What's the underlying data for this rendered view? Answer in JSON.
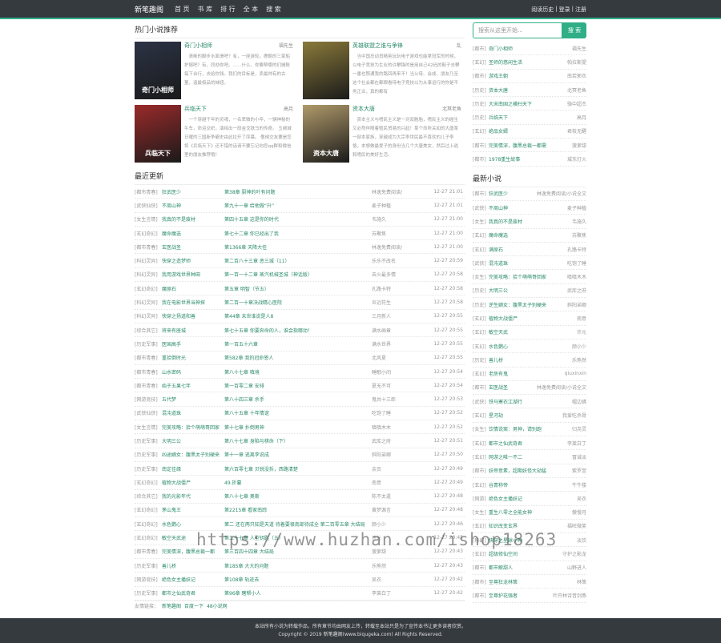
{
  "header": {
    "logo": "新笔趣阁",
    "nav": [
      "首 页",
      "书 库",
      "排 行",
      "全 本",
      "搜 索"
    ],
    "user_links": [
      "阅读历史",
      "|",
      "登录",
      "|",
      "注册"
    ]
  },
  "hot": {
    "title": "热门小说推荐",
    "books": [
      {
        "name": "奇门小相师",
        "author": "福先生",
        "cover_text": "奇门小相师",
        "cover_color": "#2c3346",
        "desc": "清晰的脚步水面滑吧？有，一座游轮。鹿鲍的三家船护撼吧？有，同劫你吧。……什么，你要帮哪的们摊账每下台行，去给你钱。我们的目标是，卖最帅有的古董，追最极品的妹妞。"
      },
      {
        "name": "英雄联盟之谁与争锋",
        "author": "乱",
        "cover_text": "",
        "cover_color": "#8a7a3a",
        "desc": "当中国总动员精英玩玩电子游戏也能拿冠军的时候，以电子竞技为生业的许攀锋的是用自己42码的鞋子去攀一番也照通我的路回再来不！当公母、会成、朋友乃至这个社会都在都眼看待电子竞技以为从事运行的你是不务正业，真的都有"
      },
      {
        "name": "兵临天下",
        "author": "高月",
        "cover_text": "兵临天下",
        "cover_color": "#9b2a2a",
        "desc": "一个穿越千年的灵魂，一名卑微的小卒，一辆神秘的牛车，命运交织，演绎出一段金戈铁马的传奇。 玉阙城日曜的三国新争霸史由此拉开了序幕。 敬候交友要是您将《兵临天下》还不错的话请不要忘记向您qq群和微信里的朋友推荐哦！"
      },
      {
        "name": "资本大唐",
        "author": "北冥老鱼",
        "cover_text": "资本大唐",
        "cover_color": "#b09a6a",
        "desc": "资本主义与嗜民主义是一对双胞胎，嗜民主义的碰生又必然伴随着殖民贸易的兴起！某个命所关如的大唐某一部本家族，穿越成为大宗李世民最不喜欢的儿子李恪，本想做最爱子的身份当几个大唐美女，然后过上逍和嗜民的美好生活。"
      }
    ]
  },
  "search": {
    "placeholder": "搜索从这里开始...",
    "button": "搜 索"
  },
  "side_top": [
    {
      "cat": "[都市]",
      "title": "奇门小相师",
      "author": "福先生"
    },
    {
      "cat": "[玄幻]",
      "title": "圣师的悠闲生活",
      "author": "帕拉斯提"
    },
    {
      "cat": "[都市]",
      "title": "游戏王朝",
      "author": "南若郭衣"
    },
    {
      "cat": "[历史]",
      "title": "资本大唐",
      "author": "北冥老鱼"
    },
    {
      "cat": "[历史]",
      "title": "大宋南国之横扫天下",
      "author": "骆中超杰"
    },
    {
      "cat": "[历史]",
      "title": "兵临天下",
      "author": "高月"
    },
    {
      "cat": "[玄幻]",
      "title": "绝品女婿",
      "author": "君枝无醒"
    },
    {
      "cat": "[都市]",
      "title": "完美情深，腹黑总裁一都需",
      "author": "菠萝甜"
    },
    {
      "cat": "[都市]",
      "title": "1978重生故事",
      "author": "城东灯火"
    }
  ],
  "latest": {
    "title": "最近更新",
    "rows": [
      {
        "cat": "[都市青春]",
        "title": "狂武医少",
        "chapter": "第38章 厨神的叶有问题",
        "author": "林逸免费阅读/",
        "time": "12-27 21:01"
      },
      {
        "cat": "[武侠仙侠]",
        "title": "不周山神",
        "chapter": "第九十一章 给他做“升”",
        "author": "麦子种植",
        "time": "12-27 21:01"
      },
      {
        "cat": "[女生言情]",
        "title": "我真的不是废材",
        "chapter": "第四十五章 这是你的时代",
        "author": "韦施久",
        "time": "12-27 21:00"
      },
      {
        "cat": "[玄幻奇幻]",
        "title": "魔命魔选",
        "chapter": "第七十二章 你已经出了我",
        "author": "苏聚焦",
        "time": "12-27 21:00"
      },
      {
        "cat": "[都市青春]",
        "title": "玄医战圣",
        "chapter": "第1366章 天降大任",
        "author": "林逸免费阅读/",
        "time": "12-27 21:00"
      },
      {
        "cat": "[科幻灵异]",
        "title": "快穿之造梦师",
        "chapter": "第二百八十三章 恶三城（11）",
        "author": "乐乐不改名",
        "time": "12-27 20:59"
      },
      {
        "cat": "[科幻灵异]",
        "title": "我用游戏世界种田",
        "chapter": "第一百一十二章 蒸汽机械圣城（神话版）",
        "author": "去火最多情",
        "time": "12-27 20:58"
      },
      {
        "cat": "[玄幻奇幻]",
        "title": "魔原石",
        "chapter": "第五章 明智（节五）",
        "author": "孔路卡特",
        "time": "12-27 20:58"
      },
      {
        "cat": "[科幻灵异]",
        "title": "我在电影世界当神探",
        "chapter": "第二百一十章决战精心医院",
        "author": "炎远符生",
        "time": "12-27 20:58"
      },
      {
        "cat": "[科幻灵异]",
        "title": "快穿之扬道和善",
        "chapter": "第44章 末世谁说是人8",
        "author": "三月新人",
        "time": "12-27 20:55"
      },
      {
        "cat": "[综合其它]",
        "title": "将来有座城",
        "chapter": "第七十五章 你要奔命的人，谁会指哪动！",
        "author": "满水画章",
        "time": "12-27 20:55"
      },
      {
        "cat": "[历史军事]",
        "title": "医国高手",
        "chapter": "第一百五十六章",
        "author": "满水世界",
        "time": "12-27 20:55"
      },
      {
        "cat": "[都市青春]",
        "title": "重拾倒时光",
        "chapter": "第582章 我的冠命恩人",
        "author": "北风夏",
        "time": "12-27 20:55"
      },
      {
        "cat": "[都市青春]",
        "title": "山水密码",
        "chapter": "第八十七章 嗔境",
        "author": "睡眠小间",
        "time": "12-27 20:54"
      },
      {
        "cat": "[都市青春]",
        "title": "始于五果七年",
        "chapter": "第一百零二章 安排",
        "author": "夏无不可",
        "time": "12-27 20:54"
      },
      {
        "cat": "[网游竞技]",
        "title": "五代梦",
        "chapter": "第八十四三章 杀手",
        "author": "鬼共十三郎",
        "time": "12-27 20:53"
      },
      {
        "cat": "[武侠仙侠]",
        "title": "混沌道珠",
        "chapter": "第八十五章 十年情谊",
        "author": "吃饱了睡",
        "time": "12-27 20:52"
      },
      {
        "cat": "[女生言情]",
        "title": "完美攻略：拾个萌萌哥回家",
        "chapter": "第十七章 扑倒男神",
        "author": "嗔嗔木木",
        "time": "12-27 20:52"
      },
      {
        "cat": "[历史军事]",
        "title": "大明三公",
        "chapter": "第八十七章 身陷与棋命（下）",
        "author": "武库之府",
        "time": "12-27 20:51"
      },
      {
        "cat": "[历史军事]",
        "title": "凶途嫡女：腹黑太子别硬来",
        "chapter": "第十一章 逃离李说成",
        "author": "斜阳弟卿",
        "time": "12-27 20:50"
      },
      {
        "cat": "[历史军事]",
        "title": "南定佳缘",
        "chapter": "第六百零七章 贝锐没拆，西路清楚",
        "author": "余页",
        "time": "12-27 20:49"
      },
      {
        "cat": "[玄幻奇幻]",
        "title": "植物大战僵尸",
        "chapter": "49.折蔓",
        "author": "南意",
        "time": "12-27 20:49"
      },
      {
        "cat": "[综合其它]",
        "title": "我的光影年代",
        "chapter": "第八十七章 奥斯",
        "author": "陈不太遣",
        "time": "12-27 20:48"
      },
      {
        "cat": "[玄幻奇幻]",
        "title": "茅山鬼王",
        "chapter": "第2215章 看家南踪",
        "author": "黄梦源言",
        "time": "12-27 20:48"
      },
      {
        "cat": "[玄幻奇幻]",
        "title": "水色鹦心",
        "chapter": "第二 还在两只知是天道 待着要很南部待成全 第二百零五章 大结局",
        "author": "颜小少",
        "time": "12-27 20:46"
      },
      {
        "cat": "[玄幻奇幻]",
        "title": "敏空天武途",
        "chapter": "第二十七章 人型钥匙（五）",
        "author": "许元",
        "time": "12-27 20:45"
      },
      {
        "cat": "[都市青春]",
        "title": "完美情深，腹黑总裁一都",
        "chapter": "第三百四十四章 大结局",
        "author": "菠萝甜",
        "time": "12-27 20:43"
      },
      {
        "cat": "[历史军事]",
        "title": "善儿桥",
        "chapter": "第185章 大大的问题",
        "author": "乐熊然",
        "time": "12-27 20:43"
      },
      {
        "cat": "[网游竞技]",
        "title": "绝色女主播妖记",
        "chapter": "第108章 轨迹去",
        "author": "吴衣",
        "time": "12-27 20:42"
      },
      {
        "cat": "[历史军事]",
        "title": "都市之仙武奇君",
        "chapter": "第96章 瞎帮小人",
        "author": "李莱白丁",
        "time": "12-27 20:42"
      }
    ]
  },
  "newest": {
    "title": "最新小说",
    "rows": [
      {
        "cat": "[都市]",
        "title": "狂武医少",
        "author": "林逸免费阅读/小说全文"
      },
      {
        "cat": "[武侠]",
        "title": "不周山神",
        "author": "麦子种植"
      },
      {
        "cat": "[女生]",
        "title": "我真的不是废材",
        "author": "韦施久"
      },
      {
        "cat": "[玄幻]",
        "title": "魔命魔选",
        "author": "苏聚焦"
      },
      {
        "cat": "[玄幻]",
        "title": "满原石",
        "author": "孔路卡特"
      },
      {
        "cat": "[武侠]",
        "title": "混沌道珠",
        "author": "吃饱了睡"
      },
      {
        "cat": "[女生]",
        "title": "完美攻略：拾个萌萌哥回家",
        "author": "嗔嗔木木"
      },
      {
        "cat": "[历史]",
        "title": "大明三公",
        "author": "武库之府"
      },
      {
        "cat": "[历史]",
        "title": "逆生嫡女：腹黑太子别硬来",
        "author": "斜阳弟卿"
      },
      {
        "cat": "[玄幻]",
        "title": "植物大战僵尸",
        "author": "南意"
      },
      {
        "cat": "[玄幻]",
        "title": "敏空天武",
        "author": "许元"
      },
      {
        "cat": "[玄幻]",
        "title": "水色鹦心",
        "author": "颜小少"
      },
      {
        "cat": "[历史]",
        "title": "善儿桥",
        "author": "乐熊然"
      },
      {
        "cat": "[玄幻]",
        "title": "老房有鬼",
        "author": "qiuxinxin"
      },
      {
        "cat": "[都市]",
        "title": "玄医战圣",
        "author": "林逸免费阅读/小说全文"
      },
      {
        "cat": "[武侠]",
        "title": "铁马寒衣江湖行",
        "author": "帽边拂"
      },
      {
        "cat": "[玄幻]",
        "title": "星河劫",
        "author": "我爱吃杀骨"
      },
      {
        "cat": "[女生]",
        "title": "饮情说案：男神，请别跑",
        "author": "归尧灵"
      },
      {
        "cat": "[玄幻]",
        "title": "都市之仙武奇君",
        "author": "李莱白丁"
      },
      {
        "cat": "[玄幻]",
        "title": "网游之唯一不二",
        "author": "冒诚淡"
      },
      {
        "cat": "[都市]",
        "title": "妖帝意素，超期妖怪大劫猛",
        "author": "紫罗翌"
      },
      {
        "cat": "[玄幻]",
        "title": "谷青称帝",
        "author": "牛牛楼"
      },
      {
        "cat": "[网游]",
        "title": "绝色女主播妖记",
        "author": "吴衣"
      },
      {
        "cat": "[女生]",
        "title": "重生八零之全能女神",
        "author": "傲慢月"
      },
      {
        "cat": "[玄幻]",
        "title": "知识改变玄界",
        "author": "福旺微笑"
      },
      {
        "cat": "[科幻]",
        "title": "快穿之星球小神",
        "author": "淡饮"
      },
      {
        "cat": "[玄幻]",
        "title": "超级修仙空间",
        "author": "守护之影龙"
      },
      {
        "cat": "[都市]",
        "title": "都市解甜人",
        "author": "山野进人"
      },
      {
        "cat": "[都市]",
        "title": "至尊狂龙林策",
        "author": "林策"
      },
      {
        "cat": "[都市]",
        "title": "至尊护花强者",
        "author": "叶开林诗音剑燕"
      }
    ]
  },
  "friend_links": {
    "label": "友情链接：",
    "items": [
      "新笔趣阁",
      "百度一下",
      "48小说网"
    ]
  },
  "footer": {
    "line1": "本站所有小说为转载作品，所有章节均由网友上传，转载至本站只是为了宣传本书让更多读者欣赏。",
    "line2": "Copyright © 2019 新笔趣阁(www.biqugeka.com) All Rights Reserved."
  },
  "watermark": "https://www.huzhan.com/ishop18263"
}
